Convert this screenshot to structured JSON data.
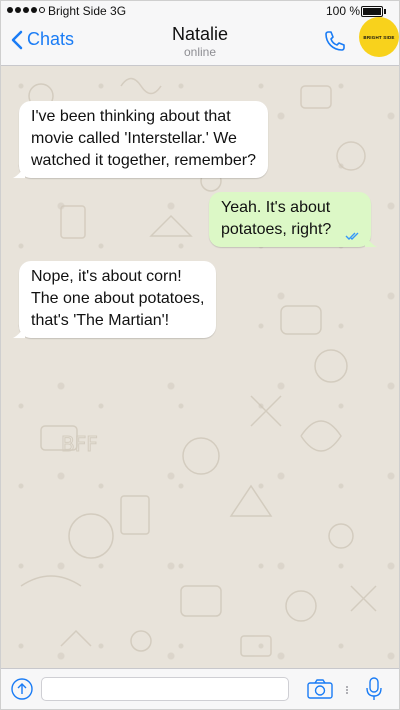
{
  "status_bar": {
    "carrier": "Bright Side 3G",
    "battery": "100 %"
  },
  "header": {
    "back_label": "Chats",
    "contact_name": "Natalie",
    "contact_status": "online",
    "badge_text": "BRIGHT SIDE",
    "accent_color": "#1a7cf5",
    "badge_color": "#f8d21c"
  },
  "messages": [
    {
      "direction": "incoming",
      "lines": [
        "I've been thinking about that",
        "movie called 'Interstellar.' We",
        "watched it together, remember?"
      ]
    },
    {
      "direction": "outgoing",
      "lines": [
        "Yeah. It's about",
        "potatoes, right?"
      ],
      "status_icon": "double-check-read-icon"
    },
    {
      "direction": "incoming",
      "lines": [
        "Nope, it's about corn!",
        "The one about potatoes,",
        "that's 'The Martian'!"
      ]
    }
  ],
  "colors": {
    "incoming_bubble": "#ffffff",
    "outgoing_bubble": "#dcf8c6",
    "chat_background": "#e8e3da"
  },
  "input_bar": {
    "message_value": "",
    "icons": [
      "share-icon",
      "camera-icon",
      "microphone-icon"
    ]
  }
}
